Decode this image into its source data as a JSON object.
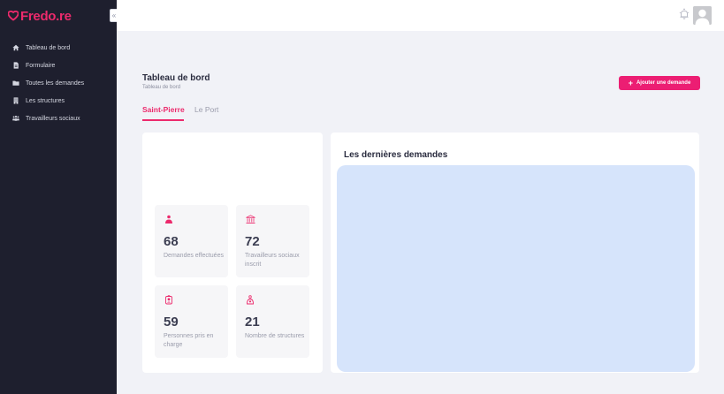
{
  "app": {
    "logo_text": "Fredo.re"
  },
  "sidebar": {
    "collapse_symbol": "«",
    "items": [
      {
        "label": "Tableau de bord",
        "icon": "home-icon"
      },
      {
        "label": "Formulaire",
        "icon": "document-icon"
      },
      {
        "label": "Toutes les demandes",
        "icon": "folder-icon"
      },
      {
        "label": "Les structures",
        "icon": "building-icon"
      },
      {
        "label": "Travailleurs sociaux",
        "icon": "users-icon"
      }
    ]
  },
  "header": {
    "bell_icon": "bell-icon",
    "avatar_icon": "user-avatar-icon"
  },
  "page": {
    "title": "Tableau de bord",
    "breadcrumb": "Tableau de bord",
    "add_button": "Ajouter une demande"
  },
  "tabs": [
    {
      "label": "Saint-Pierre",
      "active": true
    },
    {
      "label": "Le Port",
      "active": false
    }
  ],
  "stats": [
    {
      "value": "68",
      "label": "Demandes effectuées",
      "icon": "person-icon"
    },
    {
      "value": "72",
      "label": "Travailleurs sociaux inscrit",
      "icon": "institution-icon"
    },
    {
      "value": "59",
      "label": "Personnes pris en charge",
      "icon": "badge-icon"
    },
    {
      "value": "21",
      "label": "Nombre de structures",
      "icon": "structure-icon"
    }
  ],
  "recent": {
    "title": "Les dernières demandes"
  },
  "colors": {
    "accent": "#ec1e73",
    "sidebar_bg": "#1e1f2e",
    "page_bg": "#f1f2f7",
    "panel_bg": "#d6e4fb"
  }
}
